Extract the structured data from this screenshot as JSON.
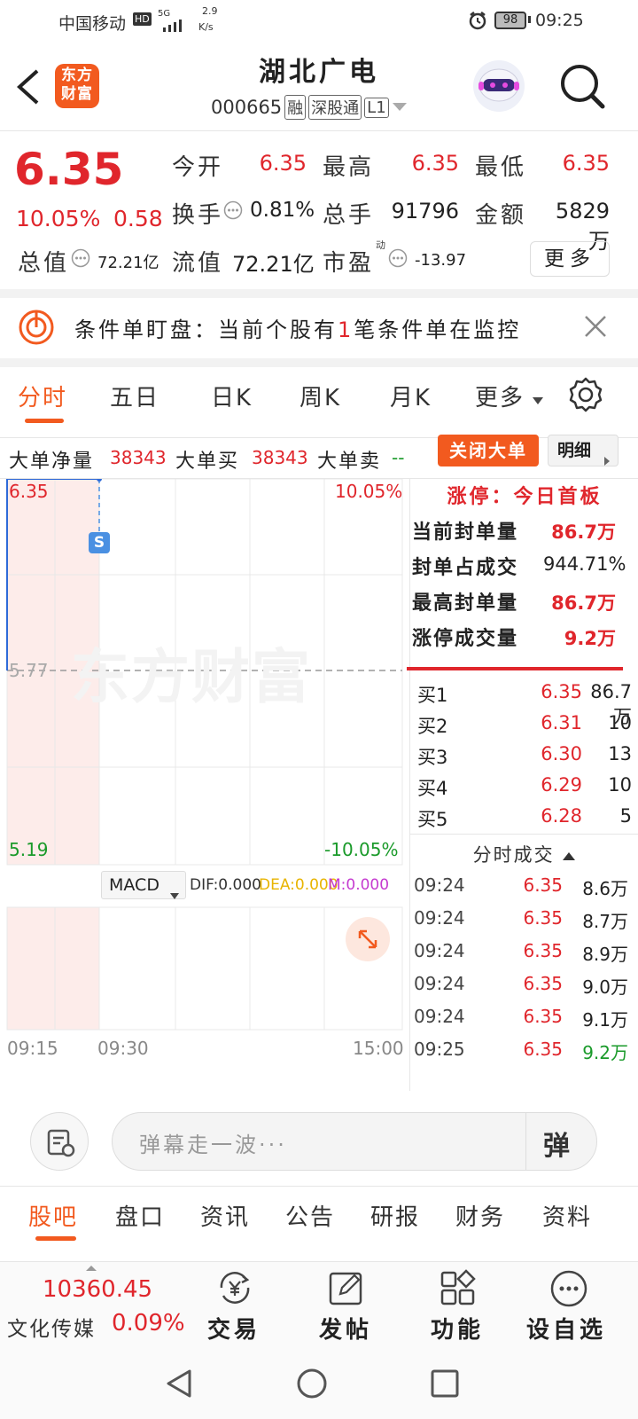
{
  "status": {
    "carrier": "中国移动",
    "hd": "HD",
    "net": "5G",
    "speed_top": "2.9",
    "speed_unit": "K/s",
    "battery": "98",
    "time": "09:25"
  },
  "header": {
    "brand": "东方财富",
    "stock_name": "湖北广电",
    "code": "000665",
    "tags": [
      "融",
      "深股通",
      "L1"
    ]
  },
  "quote": {
    "price": "6.35",
    "pct": "10.05%",
    "change": "0.58",
    "open_label": "今开",
    "open": "6.35",
    "high_label": "最高",
    "high": "6.35",
    "low_label": "最低",
    "low": "6.35",
    "turnover_label": "换手",
    "turnover": "0.81%",
    "volume_label": "总手",
    "volume": "91796",
    "amount_label": "金额",
    "amount": "5829万",
    "mcap_label": "总值",
    "mcap": "72.21亿",
    "float_label": "流值",
    "float_cap": "72.21亿",
    "pe_label": "市盈",
    "pe_sup": "动",
    "pe": "-13.97",
    "more": "更多"
  },
  "condition": {
    "text_a": "条件单盯盘：当前个股有",
    "count": "1",
    "text_b": "笔条件单在监控"
  },
  "tabs": [
    "分时",
    "五日",
    "日K",
    "周K",
    "月K",
    "更多"
  ],
  "bigorder": {
    "net_label": "大单净量",
    "net": "38343",
    "buy_label": "大单买",
    "buy": "38343",
    "sell_label": "大单卖",
    "sell": "--",
    "close_btn": "关闭大单",
    "detail_btn": "明细"
  },
  "chart": {
    "top_price": "6.35",
    "top_pct": "10.05%",
    "mid_price": "5.77",
    "low_price": "5.19",
    "low_pct": "-10.05%",
    "watermark": "东方财富",
    "marker": "S",
    "indicator": "MACD",
    "dif": "DIF:0.000",
    "dea": "DEA:0.000",
    "m": "M:0.000",
    "times": [
      "09:15",
      "09:30",
      "15:00"
    ]
  },
  "limit": {
    "title": "涨停：今日首板",
    "rows": [
      {
        "label": "当前封单量",
        "value": "86.7万",
        "red": true
      },
      {
        "label": "封单占成交",
        "value": "944.71%",
        "red": false
      },
      {
        "label": "最高封单量",
        "value": "86.7万",
        "red": true
      },
      {
        "label": "涨停成交量",
        "value": "9.2万",
        "red": true
      }
    ]
  },
  "bids": [
    {
      "label": "买1",
      "price": "6.35",
      "vol": "86.7万"
    },
    {
      "label": "买2",
      "price": "6.31",
      "vol": "10"
    },
    {
      "label": "买3",
      "price": "6.30",
      "vol": "13"
    },
    {
      "label": "买4",
      "price": "6.29",
      "vol": "10"
    },
    {
      "label": "买5",
      "price": "6.28",
      "vol": "5"
    }
  ],
  "trades_title": "分时成交",
  "trades": [
    {
      "time": "09:24",
      "price": "6.35",
      "vol": "8.6万"
    },
    {
      "time": "09:24",
      "price": "6.35",
      "vol": "8.7万"
    },
    {
      "time": "09:24",
      "price": "6.35",
      "vol": "8.9万"
    },
    {
      "time": "09:24",
      "price": "6.35",
      "vol": "9.0万"
    },
    {
      "time": "09:24",
      "price": "6.35",
      "vol": "9.1万"
    },
    {
      "time": "09:25",
      "price": "6.35",
      "vol": "9.2万"
    }
  ],
  "comment": {
    "placeholder": "弹幕走一波···",
    "send": "弹"
  },
  "bottom_tabs": [
    "股吧",
    "盘口",
    "资讯",
    "公告",
    "研报",
    "财务",
    "资料"
  ],
  "bottom": {
    "index_value": "10360.45",
    "index_name": "文化传媒",
    "index_pct": "0.09%",
    "trade": "交易",
    "post": "发帖",
    "func": "功能",
    "watch": "设自选"
  },
  "colors": {
    "red": "#e0262c",
    "green": "#1a9a2a",
    "orange": "#f25a1f"
  }
}
